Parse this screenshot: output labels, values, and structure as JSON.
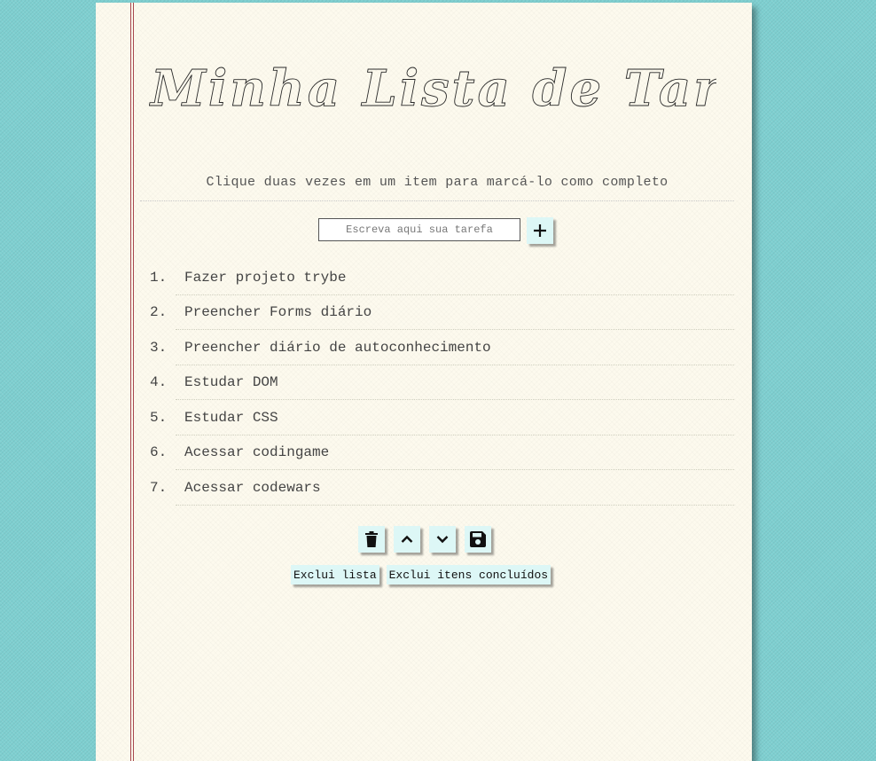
{
  "header": {
    "title": "Minha Lista de Tarefas",
    "instructions": "Clique duas vezes em um item para marcá-lo como completo"
  },
  "input": {
    "placeholder": "Escreva aqui sua tarefa",
    "value": ""
  },
  "add_button": {
    "icon": "plus-icon",
    "label": "+"
  },
  "tasks": [
    {
      "number": "1.",
      "text": "Fazer projeto trybe"
    },
    {
      "number": "2.",
      "text": "Preencher Forms diário"
    },
    {
      "number": "3.",
      "text": "Preencher diário de autoconhecimento"
    },
    {
      "number": "4.",
      "text": "Estudar DOM"
    },
    {
      "number": "5.",
      "text": "Estudar CSS"
    },
    {
      "number": "6.",
      "text": "Acessar codingame"
    },
    {
      "number": "7.",
      "text": "Acessar codewars"
    }
  ],
  "controls": {
    "icon_buttons": [
      "trash-icon",
      "chevron-up-icon",
      "chevron-down-icon",
      "save-icon"
    ],
    "clear_list_label": "Exclui lista",
    "clear_completed_label": "Exclui itens concluídos"
  },
  "colors": {
    "background": "#7ecfd0",
    "paper": "#fdfaee",
    "margin_line": "#a8474f",
    "button_bg": "#ddf7f6",
    "text": "#444444"
  }
}
